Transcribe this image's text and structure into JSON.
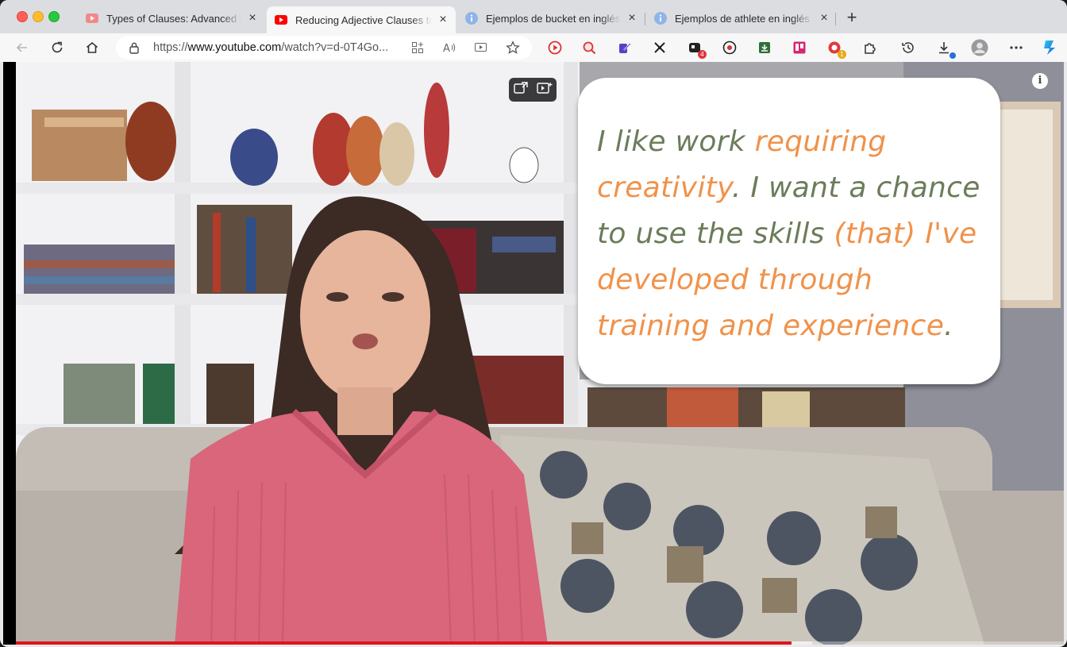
{
  "window": {
    "controls": [
      "close",
      "minimize",
      "maximize"
    ]
  },
  "tabs": [
    {
      "title": "Types of Clauses: Advanced En",
      "favicon": "youtube-icon",
      "active": false
    },
    {
      "title": "Reducing Adjective Clauses to",
      "favicon": "youtube-icon",
      "active": true
    },
    {
      "title": "Ejemplos de bucket en inglés |",
      "favicon": "info-icon",
      "active": false
    },
    {
      "title": "Ejemplos de athlete en inglés |",
      "favicon": "info-icon",
      "active": false
    }
  ],
  "address_bar": {
    "url_prefix": "https://",
    "url_domain": "www.youtube.com",
    "url_rest": "/watch?v=d-0T4Go..."
  },
  "extensions": [
    {
      "name": "video-play-icon",
      "badge": ""
    },
    {
      "name": "search-magnify-icon",
      "badge": ""
    },
    {
      "name": "pen-edit-icon",
      "badge": ""
    },
    {
      "name": "scatter-arrows-icon",
      "badge": ""
    },
    {
      "name": "extension-counter-icon",
      "badge": "4"
    },
    {
      "name": "record-video-icon",
      "badge": ""
    },
    {
      "name": "download-box-icon",
      "badge": ""
    },
    {
      "name": "trello-board-icon",
      "badge": ""
    },
    {
      "name": "record-dot-icon",
      "badge": "1"
    }
  ],
  "video": {
    "caption_parts": [
      {
        "text": "I like work ",
        "highlight": false
      },
      {
        "text": "requiring creativity",
        "highlight": true
      },
      {
        "text": ". I want a chance to use the skills ",
        "highlight": false
      },
      {
        "text": "(that) I've developed through training and experience",
        "highlight": true
      },
      {
        "text": ".",
        "highlight": false
      }
    ],
    "progress_played": 0.74,
    "progress_buffered": 0.76
  },
  "colors": {
    "caption_green": "#6b7c5a",
    "caption_orange": "#f0924a",
    "progress_red": "#e0141e"
  }
}
